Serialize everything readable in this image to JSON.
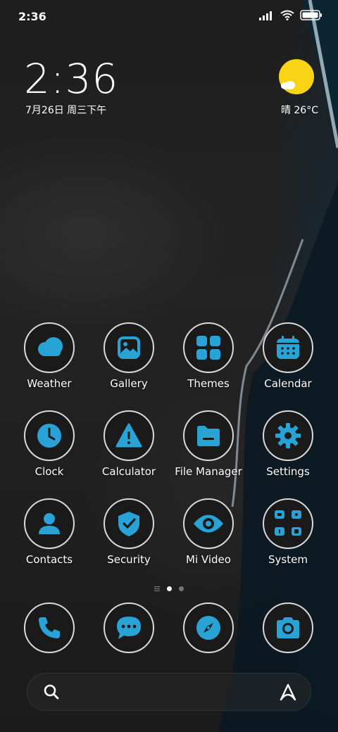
{
  "status_bar": {
    "time": "2:36"
  },
  "lock_widget": {
    "time": "2:36",
    "date": "7月26日 周三下午",
    "weather": "晴 26°C"
  },
  "accent_color": "#29a3d6",
  "apps": [
    {
      "label": "Weather",
      "icon": "weather-cloud-icon"
    },
    {
      "label": "Gallery",
      "icon": "gallery-image-icon"
    },
    {
      "label": "Themes",
      "icon": "themes-grid-icon"
    },
    {
      "label": "Calendar",
      "icon": "calendar-icon"
    },
    {
      "label": "Clock",
      "icon": "clock-icon"
    },
    {
      "label": "Calculator",
      "icon": "calculator-warning-icon"
    },
    {
      "label": "File Manager",
      "icon": "folder-icon"
    },
    {
      "label": "Settings",
      "icon": "gear-icon"
    },
    {
      "label": "Contacts",
      "icon": "person-icon"
    },
    {
      "label": "Security",
      "icon": "shield-check-icon"
    },
    {
      "label": "Mi Video",
      "icon": "eye-icon"
    },
    {
      "label": "System",
      "icon": "folder-grid-icon"
    }
  ],
  "dock": [
    {
      "icon": "phone-icon"
    },
    {
      "icon": "message-icon"
    },
    {
      "icon": "compass-icon"
    },
    {
      "icon": "camera-icon"
    }
  ],
  "page_indicator": {
    "pages": 2,
    "current": 1
  }
}
